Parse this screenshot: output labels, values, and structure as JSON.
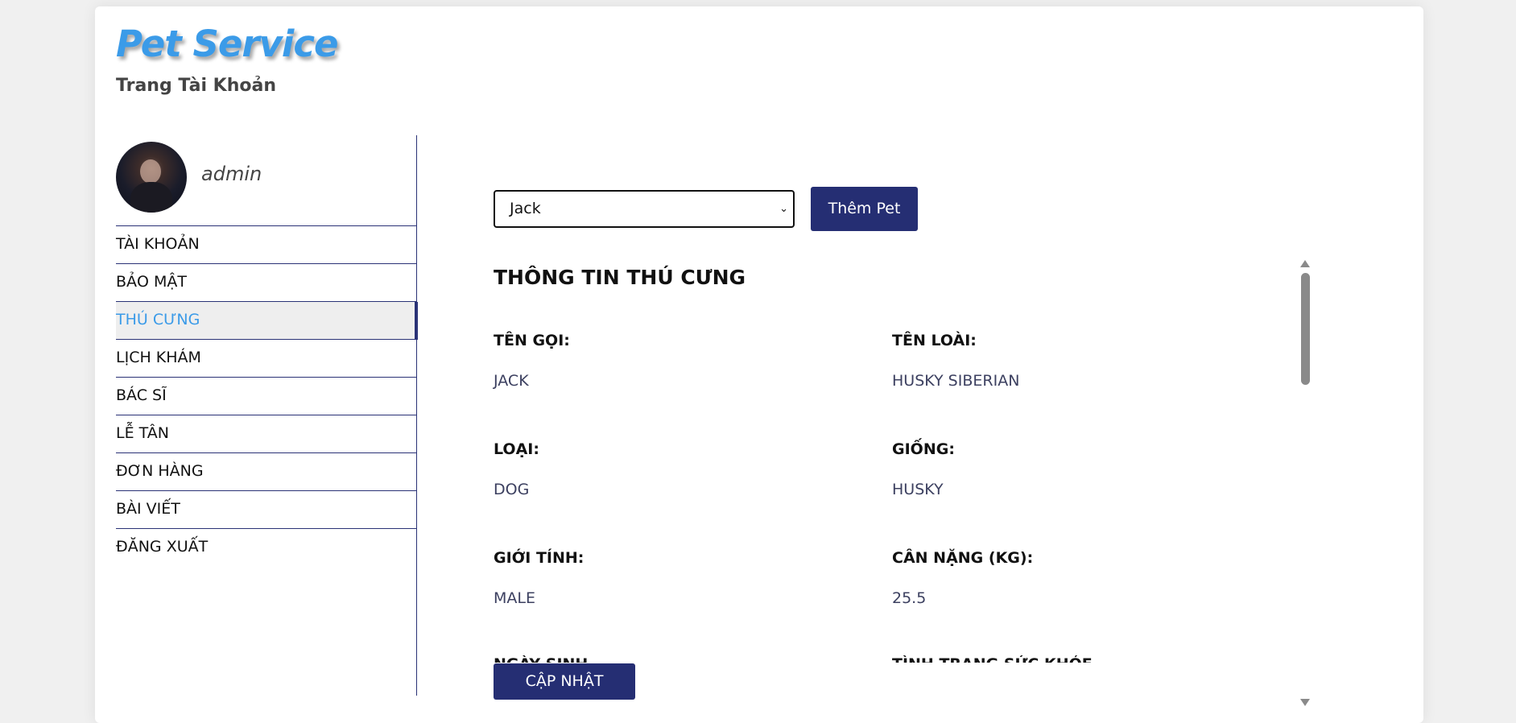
{
  "header": {
    "logo": "Pet Service",
    "subtitle": "Trang Tài Khoản"
  },
  "profile": {
    "username": "admin"
  },
  "menu": [
    {
      "label": "TÀI KHOẢN",
      "active": false
    },
    {
      "label": "BẢO MẬT",
      "active": false
    },
    {
      "label": "THÚ CƯNG",
      "active": true
    },
    {
      "label": "LỊCH KHÁM",
      "active": false
    },
    {
      "label": "BÁC SĨ",
      "active": false
    },
    {
      "label": "LỄ TÂN",
      "active": false
    },
    {
      "label": "ĐƠN HÀNG",
      "active": false
    },
    {
      "label": "BÀI VIẾT",
      "active": false
    },
    {
      "label": "ĐĂNG XUẤT",
      "active": false
    }
  ],
  "pet_select": {
    "selected": "Jack"
  },
  "buttons": {
    "add_pet": "Thêm Pet",
    "update": "CẬP NHẬT"
  },
  "pet_info": {
    "title": "THÔNG TIN THÚ CƯNG",
    "fields": [
      {
        "label": "TÊN GỌI:",
        "value": "JACK"
      },
      {
        "label": "TÊN LOÀI:",
        "value": "HUSKY SIBERIAN"
      },
      {
        "label": "LOẠI:",
        "value": "DOG"
      },
      {
        "label": "GIỐNG:",
        "value": "HUSKY"
      },
      {
        "label": "GIỚI TÍNH:",
        "value": "MALE"
      },
      {
        "label": "CÂN NẶNG (KG):",
        "value": "25.5"
      }
    ],
    "partial_labels": [
      "NGÀY SINH",
      "TÌNH TRẠNG SỨC KHỎE"
    ]
  },
  "colors": {
    "accent": "#3b9be8",
    "primary": "#252e73",
    "value_text": "#3c4060"
  }
}
